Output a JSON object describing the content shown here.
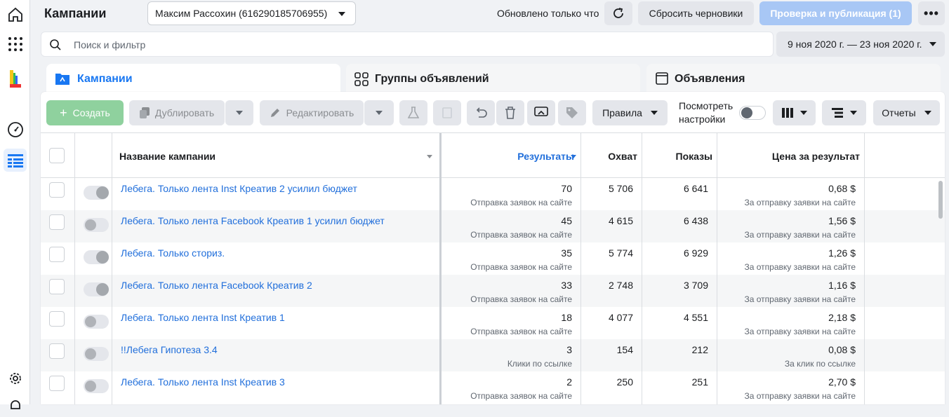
{
  "colors": {
    "accent": "#216fdb",
    "publish": "#a8c7f5",
    "create": "#8fd19e"
  },
  "rail": {
    "icons": [
      "home-icon",
      "apps-grid-icon",
      "brand-logo-icon",
      "gauge-icon",
      "table-icon",
      "gear-icon",
      "bell-icon"
    ]
  },
  "topbar": {
    "title": "Кампании",
    "account": "Максим Рассохин (616290185706955)",
    "updated": "Обновлено только что",
    "discard": "Сбросить черновики",
    "publish": "Проверка и публикация (1)"
  },
  "search": {
    "placeholder": "Поиск и фильтр"
  },
  "date_range": "9 ноя 2020 г. — 23 ноя 2020 г.",
  "tabs": {
    "campaigns": "Кампании",
    "adsets": "Группы объявлений",
    "ads": "Объявления"
  },
  "toolbar": {
    "create": "Создать",
    "duplicate": "Дублировать",
    "edit": "Редактировать",
    "rules": "Правила",
    "view_settings_1": "Посмотреть",
    "view_settings_2": "настройки",
    "reports": "Отчеты"
  },
  "table": {
    "headers": {
      "name": "Название кампании",
      "results": "Результаты",
      "reach": "Охват",
      "impressions": "Показы",
      "cost": "Цена за результат"
    },
    "rows": [
      {
        "name": "Лебега. Только лента Inst Креатив 2 усилил бюджет",
        "on": true,
        "results": "70",
        "results_type": "Отправка заявок на сайте",
        "reach": "5 706",
        "impressions": "6 641",
        "cost": "0,68 $",
        "cost_type": "За отправку заявки на сайте"
      },
      {
        "name": "Лебега. Только лента Facebook Креатив 1 усилил бюджет",
        "on": false,
        "results": "45",
        "results_type": "Отправка заявок на сайте",
        "reach": "4 615",
        "impressions": "6 438",
        "cost": "1,56 $",
        "cost_type": "За отправку заявки на сайте"
      },
      {
        "name": "Лебега. Только сториз.",
        "on": true,
        "results": "35",
        "results_type": "Отправка заявок на сайте",
        "reach": "5 774",
        "impressions": "6 929",
        "cost": "1,26 $",
        "cost_type": "За отправку заявки на сайте"
      },
      {
        "name": "Лебега. Только лента Facebook Креатив 2",
        "on": true,
        "results": "33",
        "results_type": "Отправка заявок на сайте",
        "reach": "2 748",
        "impressions": "3 709",
        "cost": "1,16 $",
        "cost_type": "За отправку заявки на сайте"
      },
      {
        "name": "Лебега. Только лента Inst Креатив 1",
        "on": false,
        "results": "18",
        "results_type": "Отправка заявок на сайте",
        "reach": "4 077",
        "impressions": "4 551",
        "cost": "2,18 $",
        "cost_type": "За отправку заявки на сайте"
      },
      {
        "name": "!!Лебега Гипотеза 3.4",
        "on": false,
        "results": "3",
        "results_type": "Клики по ссылке",
        "reach": "154",
        "impressions": "212",
        "cost": "0,08 $",
        "cost_type": "За клик по ссылке"
      },
      {
        "name": "Лебега. Только лента Inst Креатив 3",
        "on": false,
        "results": "2",
        "results_type": "Отправка заявок на сайте",
        "reach": "250",
        "impressions": "251",
        "cost": "2,70 $",
        "cost_type": "За отправку заявки на сайте"
      }
    ]
  }
}
